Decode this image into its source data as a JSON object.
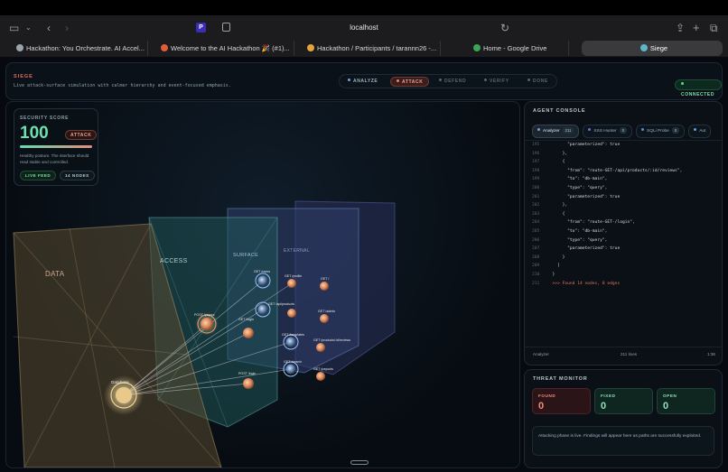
{
  "browser": {
    "address": "localhost",
    "tabs": [
      {
        "label": "Hackathon: You Orchestrate. AI Accel...",
        "color": "#9aa4ad"
      },
      {
        "label": "Welcome to the AI Hackathon 🎉 (#1)...",
        "color": "#e25b3a"
      },
      {
        "label": "Hackathon / Participants / tarannn26 -...",
        "color": "#e8a23a"
      },
      {
        "label": "Home - Google Drive",
        "color": "#3aa757"
      },
      {
        "label": "Siege",
        "color": "#5bb7c9"
      }
    ]
  },
  "header": {
    "brand": "SIEGE",
    "subtitle": "Live attack-surface simulation with calmer hierarchy and event-focused emphasis.",
    "phases": [
      "ANALYZE",
      "ATTACK",
      "DEFEND",
      "VERIFY",
      "DONE"
    ],
    "connection": "CONNECTED"
  },
  "score": {
    "label": "SECURITY SCORE",
    "value": "100",
    "badge": "ATTACK",
    "description": "Healthy posture. The interface should read stable and controlled.",
    "pills": [
      "LIVE FEED",
      "14 NODES"
    ]
  },
  "scene": {
    "layers": [
      "DATA",
      "ACCESS",
      "SURFACE",
      "EXTERNAL"
    ],
    "nodes": {
      "database": "Database",
      "post_payout": "POST /payout",
      "get_login": "GET /login",
      "post_login": "POST /login",
      "get_users": "GET /users",
      "get_api_products": "GET /api/products",
      "get_templates": "GET /templates",
      "get_search": "GET /search",
      "get_profile": "GET /profile",
      "get_root": "GET /",
      "get_admin": "GET /admin",
      "get_reviews": "GET /products/:id/reviews",
      "get_payouts": "GET /payouts"
    }
  },
  "console": {
    "title": "AGENT CONSOLE",
    "tabs": [
      {
        "label": "Analyzer",
        "count": "211"
      },
      {
        "label": "XSS Hunter",
        "count": "0"
      },
      {
        "label": "SQLi Probe",
        "count": "0"
      },
      {
        "label": "Aut",
        "count": ""
      }
    ],
    "lines": [
      {
        "n": "195",
        "t": "        \"parameterized\": true"
      },
      {
        "n": "196",
        "t": "      },"
      },
      {
        "n": "197",
        "t": "      {"
      },
      {
        "n": "198",
        "t": "        \"from\": \"route-GET-/api/products/:id/reviews\","
      },
      {
        "n": "199",
        "t": "        \"to\": \"db-main\","
      },
      {
        "n": "200",
        "t": "        \"type\": \"query\","
      },
      {
        "n": "201",
        "t": "        \"parameterized\": true"
      },
      {
        "n": "202",
        "t": "      },"
      },
      {
        "n": "203",
        "t": "      {"
      },
      {
        "n": "204",
        "t": "        \"from\": \"route-GET-/login\","
      },
      {
        "n": "205",
        "t": "        \"to\": \"db-main\","
      },
      {
        "n": "206",
        "t": "        \"type\": \"query\","
      },
      {
        "n": "207",
        "t": "        \"parameterized\": true"
      },
      {
        "n": "208",
        "t": "      }"
      },
      {
        "n": "209",
        "t": "    ]"
      },
      {
        "n": "210",
        "t": "  }"
      },
      {
        "n": "211",
        "t": "  >>> Found 14 nodes, 8 edges"
      }
    ],
    "footer": {
      "agent": "Analyzer",
      "lines": "211 lines",
      "time": "1:36"
    }
  },
  "threat": {
    "title": "THREAT MONITOR",
    "stats": [
      {
        "label": "FOUND",
        "value": "0"
      },
      {
        "label": "FIXED",
        "value": "0"
      },
      {
        "label": "OPEN",
        "value": "0"
      }
    ],
    "note": "Attacking phase is live. Findings will appear here as paths are successfully exploited."
  },
  "colors": {
    "accent": "#ff7a5c",
    "good": "#6ee0b0",
    "brand": "#e0705a"
  }
}
